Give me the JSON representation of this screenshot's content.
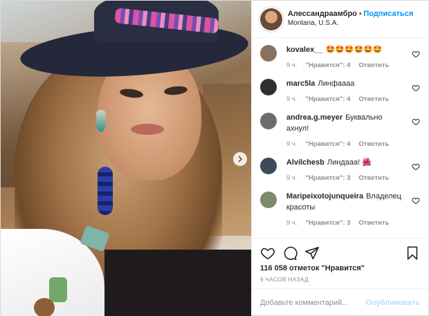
{
  "post": {
    "author": {
      "username": "Алессандраамбро",
      "separator": "•",
      "follow_label": "Подписаться",
      "location": "Montana, U.S.A."
    },
    "comments": [
      {
        "username": "kovalex__",
        "text": "🤩🤩🤩🤩🤩🤩",
        "time": "9 ч.",
        "likes": "\"Нравится\": 4",
        "reply": "Ответить",
        "avatar_color": "#8a7260"
      },
      {
        "username": "marc5la",
        "text": "Линфаааа",
        "time": "9 ч.",
        "likes": "\"Нравится\": 4",
        "reply": "Ответить",
        "avatar_color": "#2f2f2f"
      },
      {
        "username": "andrea.g.meyer",
        "text": "Буквально ахнул!",
        "time": "9 ч.",
        "likes": "\"Нравится\": 4",
        "reply": "Ответить",
        "avatar_color": "#6d6d6d"
      },
      {
        "username": "Alvilchesb",
        "text": "Линдааа! 🌺",
        "time": "9 ч.",
        "likes": "\"Нравится\": 3",
        "reply": "Ответить",
        "avatar_color": "#3d4a5c"
      },
      {
        "username": "Maripeixotojunqueira",
        "text": "Владелец красоты",
        "time": "9 ч.",
        "likes": "\"Нравится\": 3",
        "reply": "Ответить",
        "avatar_color": "#7a8a6a"
      }
    ],
    "actions": {
      "like_icon": "heart-icon",
      "comment_icon": "comment-icon",
      "share_icon": "share-icon",
      "save_icon": "bookmark-icon"
    },
    "likes_text": "116 058 отметок \"Нравится\"",
    "posted_time": "9 ЧАСОВ НАЗАД",
    "add_comment": {
      "placeholder": "Добавьте комментарий...",
      "publish_label": "Опубликовать"
    }
  }
}
